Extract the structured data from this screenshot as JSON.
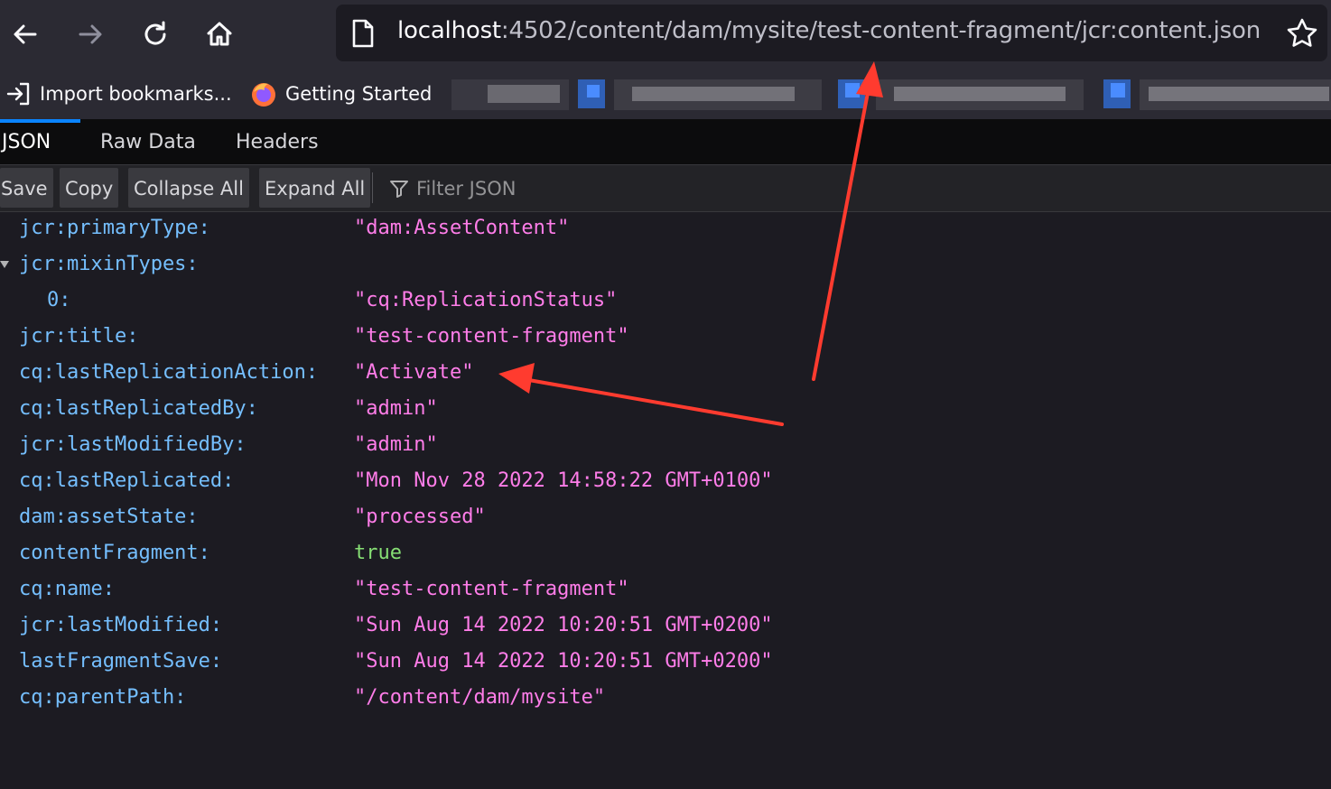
{
  "browser": {
    "url_host": "localhost",
    "url_rest": ":4502/content/dam/mysite/test-content-fragment/jcr:content.json",
    "bookmarks": [
      {
        "label": "Import bookmarks...",
        "icon": "import-icon"
      },
      {
        "label": "Getting Started",
        "icon": "firefox-icon"
      }
    ]
  },
  "viewer": {
    "tabs": [
      "JSON",
      "Raw Data",
      "Headers"
    ],
    "active_tab": "JSON",
    "buttons": {
      "save": "Save",
      "copy": "Copy",
      "collapse_all": "Collapse All",
      "expand_all": "Expand All"
    },
    "filter_placeholder": "Filter JSON"
  },
  "json_rows": [
    {
      "key": "jcr:primaryType:",
      "value": "\"dam:AssetContent\"",
      "type": "string"
    },
    {
      "key": "jcr:mixinTypes:",
      "value": "",
      "type": "array"
    },
    {
      "key": "0:",
      "value": "\"cq:ReplicationStatus\"",
      "type": "string"
    },
    {
      "key": "jcr:title:",
      "value": "\"test-content-fragment\"",
      "type": "string"
    },
    {
      "key": "cq:lastReplicationAction:",
      "value": "\"Activate\"",
      "type": "string"
    },
    {
      "key": "cq:lastReplicatedBy:",
      "value": "\"admin\"",
      "type": "string"
    },
    {
      "key": "jcr:lastModifiedBy:",
      "value": "\"admin\"",
      "type": "string"
    },
    {
      "key": "cq:lastReplicated:",
      "value": "\"Mon Nov 28 2022 14:58:22 GMT+0100\"",
      "type": "string"
    },
    {
      "key": "dam:assetState:",
      "value": "\"processed\"",
      "type": "string"
    },
    {
      "key": "contentFragment:",
      "value": "true",
      "type": "boolean"
    },
    {
      "key": "cq:name:",
      "value": "\"test-content-fragment\"",
      "type": "string"
    },
    {
      "key": "jcr:lastModified:",
      "value": "\"Sun Aug 14 2022 10:20:51 GMT+0200\"",
      "type": "string"
    },
    {
      "key": "lastFragmentSave:",
      "value": "\"Sun Aug 14 2022 10:20:51 GMT+0200\"",
      "type": "string"
    },
    {
      "key": "cq:parentPath:",
      "value": "\"/content/dam/mysite\"",
      "type": "string"
    }
  ],
  "colors": {
    "key": "#75bfff",
    "string": "#ff7de9",
    "boolean": "#86de74",
    "annotation_arrow": "#ff3b2f"
  }
}
